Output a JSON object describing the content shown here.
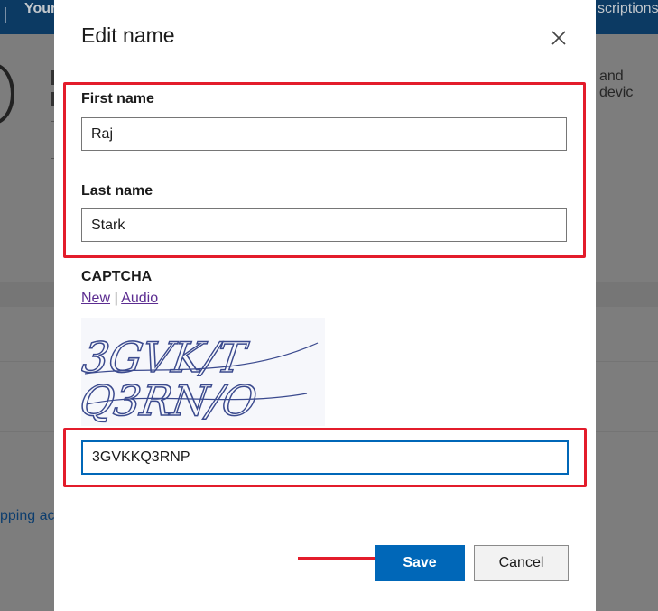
{
  "background": {
    "top_left_text": "Your",
    "top_right_text": "scriptions",
    "right_text": "and devic",
    "left_text": "pping ac"
  },
  "dialog": {
    "title": "Edit name",
    "close_icon": "close-icon",
    "first_name": {
      "label": "First name",
      "value": "Raj"
    },
    "last_name": {
      "label": "Last name",
      "value": "Stark"
    },
    "captcha": {
      "label": "CAPTCHA",
      "new_link": "New",
      "separator": "|",
      "audio_link": "Audio",
      "image_line1": "3GVK/T",
      "image_line2": "Q3RN/O",
      "input_value": "3GVKKQ3RNP"
    },
    "buttons": {
      "save": "Save",
      "cancel": "Cancel"
    }
  },
  "colors": {
    "accent": "#0067b8",
    "highlight": "#e31c2b",
    "link": "#5c2d91",
    "overlay": "#7d7d7d"
  }
}
